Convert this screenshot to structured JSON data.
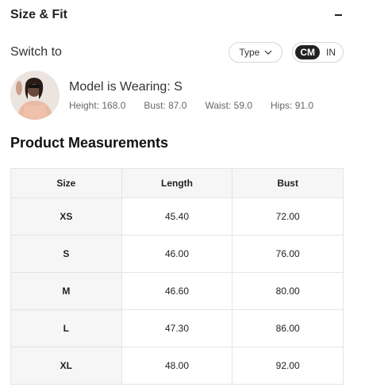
{
  "header": {
    "title": "Size & Fit"
  },
  "switch": {
    "label": "Switch to",
    "type_label": "Type",
    "units": [
      "CM",
      "IN"
    ],
    "active_unit": "CM"
  },
  "model": {
    "wearing": "Model is Wearing: S",
    "stats": [
      "Height: 168.0",
      "Bust: 87.0",
      "Waist: 59.0",
      "Hips: 91.0"
    ]
  },
  "measurements": {
    "title": "Product Measurements",
    "columns": [
      "Size",
      "Length",
      "Bust"
    ],
    "rows": [
      [
        "XS",
        "45.40",
        "72.00"
      ],
      [
        "S",
        "46.00",
        "76.00"
      ],
      [
        "M",
        "46.60",
        "80.00"
      ],
      [
        "L",
        "47.30",
        "86.00"
      ],
      [
        "XL",
        "48.00",
        "92.00"
      ]
    ]
  },
  "colors": {
    "toggle_active_bg": "#222222",
    "header_bg": "#f6f6f6",
    "border": "#e4e4e4"
  }
}
